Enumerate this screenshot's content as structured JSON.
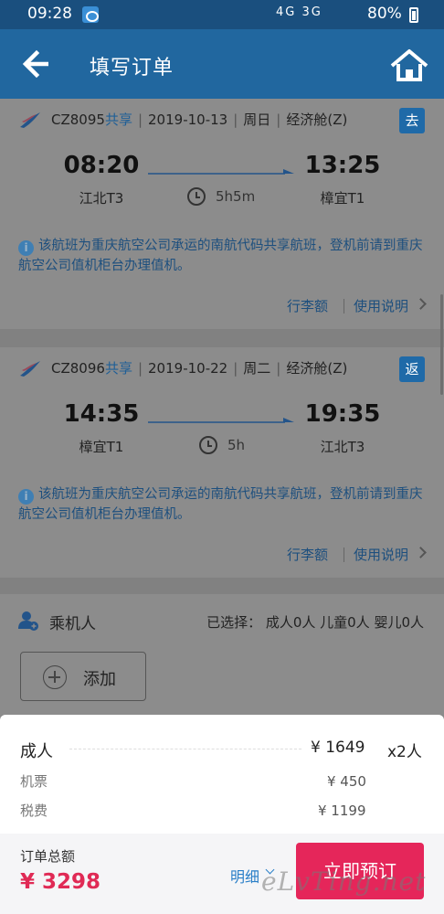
{
  "status_bar": {
    "time": "09:28",
    "network": "4G 3G",
    "battery": "80%"
  },
  "header": {
    "title": "填写订单"
  },
  "flights": [
    {
      "flight_no": "CZ8095",
      "share": "共享",
      "date": "2019-10-13",
      "weekday": "周日",
      "cabin": "经济舱(Z)",
      "direction": "去",
      "dep_time": "08:20",
      "dep_airport": "江北T3",
      "arr_time": "13:25",
      "arr_airport": "樟宜T1",
      "duration": "5h5m",
      "notice": "该航班为重庆航空公司承运的南航代码共享航班，登机前请到重庆航空公司值机柜台办理值机。",
      "baggage_link": "行李额",
      "usage_link": "使用说明"
    },
    {
      "flight_no": "CZ8096",
      "share": "共享",
      "date": "2019-10-22",
      "weekday": "周二",
      "cabin": "经济舱(Z)",
      "direction": "返",
      "dep_time": "14:35",
      "dep_airport": "樟宜T1",
      "arr_time": "19:35",
      "arr_airport": "江北T3",
      "duration": "5h",
      "notice": "该航班为重庆航空公司承运的南航代码共享航班，登机前请到重庆航空公司值机柜台办理值机。",
      "baggage_link": "行李额",
      "usage_link": "使用说明"
    }
  ],
  "passengers": {
    "label": "乘机人",
    "selected": "已选择：  成人0人  儿童0人  婴儿0人",
    "add_label": "添加"
  },
  "price": {
    "adult_label": "成人",
    "adult_price": "¥ 1649",
    "adult_count": "x2人",
    "ticket_label": "机票",
    "ticket_price": "¥ 450",
    "tax_label": "税费",
    "tax_price": "¥ 1199"
  },
  "footer": {
    "total_label": "订单总额",
    "total_amount": "¥ 3298",
    "detail_link": "明细",
    "book_button": "立即预订"
  },
  "watermark": "eLvTing.net",
  "colors": {
    "header": "#21679f",
    "accent": "#e5265a",
    "price": "#e02a55",
    "link": "#2a7fc8"
  }
}
